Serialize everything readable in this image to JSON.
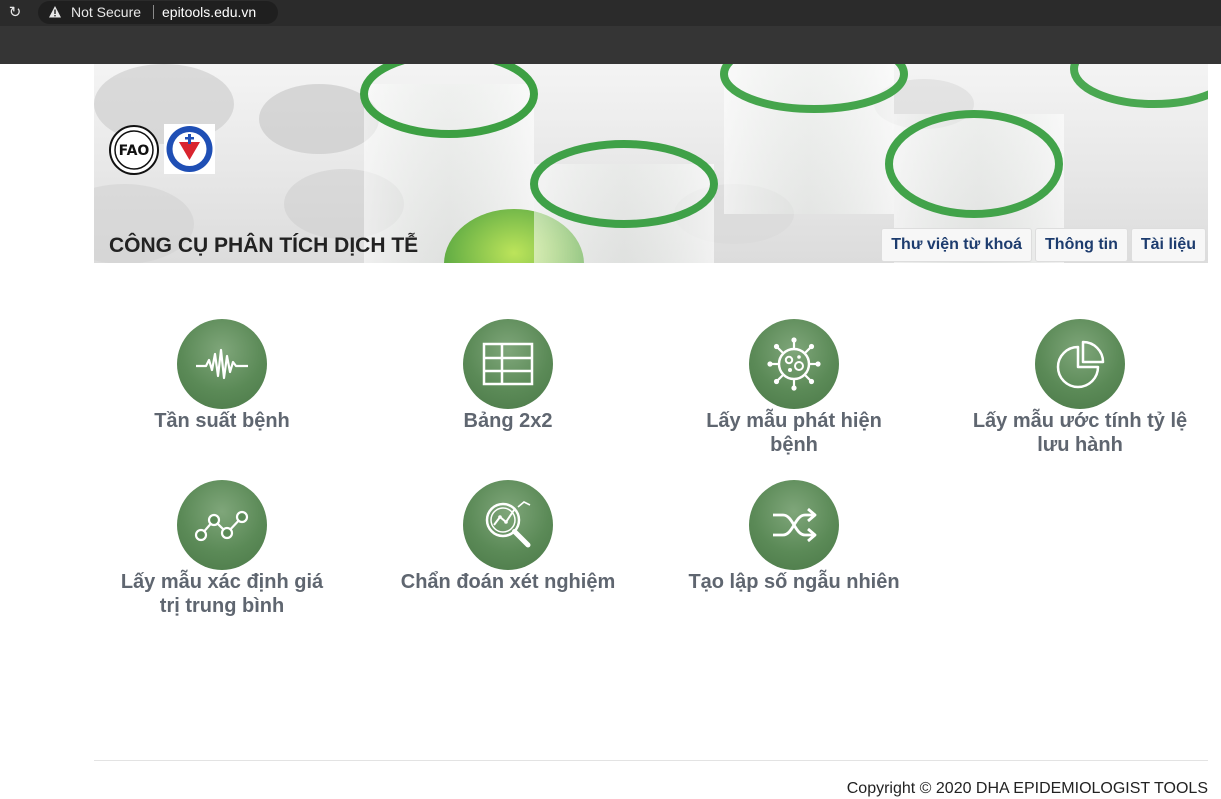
{
  "browser": {
    "security_label": "Not Secure",
    "url": "epitools.edu.vn",
    "icons": [
      "reload-icon",
      "warning-icon"
    ]
  },
  "header": {
    "title": "CÔNG CỤ PHÂN TÍCH DỊCH TỄ",
    "logos": [
      "fao-logo",
      "department-logo"
    ],
    "nav": [
      {
        "label": "Thư viện từ khoá"
      },
      {
        "label": "Thông tin"
      },
      {
        "label": "Tài liệu"
      }
    ]
  },
  "tools": [
    {
      "label": "Tần suất bệnh",
      "icon": "waveform-icon"
    },
    {
      "label": "Bảng 2x2",
      "icon": "table-grid-icon"
    },
    {
      "label": "Lấy mẫu phát hiện bệnh",
      "icon": "virus-icon"
    },
    {
      "label": "Lấy mẫu ước tính tỷ lệ lưu hành",
      "icon": "pie-chart-icon"
    },
    {
      "label": "Lấy mẫu xác định giá trị trung bình",
      "icon": "line-graph-icon"
    },
    {
      "label": "Chẩn đoán xét nghiệm",
      "icon": "magnifier-chart-icon"
    },
    {
      "label": "Tạo lập số ngẫu nhiên",
      "icon": "shuffle-icon"
    }
  ],
  "colors": {
    "icon_circle": "#5b8a57",
    "label_text": "#5f6670",
    "nav_text": "#1d3c6e"
  },
  "footer": {
    "copyright": "Copyright © 2020 DHA EPIDEMIOLOGIST TOOLS"
  }
}
